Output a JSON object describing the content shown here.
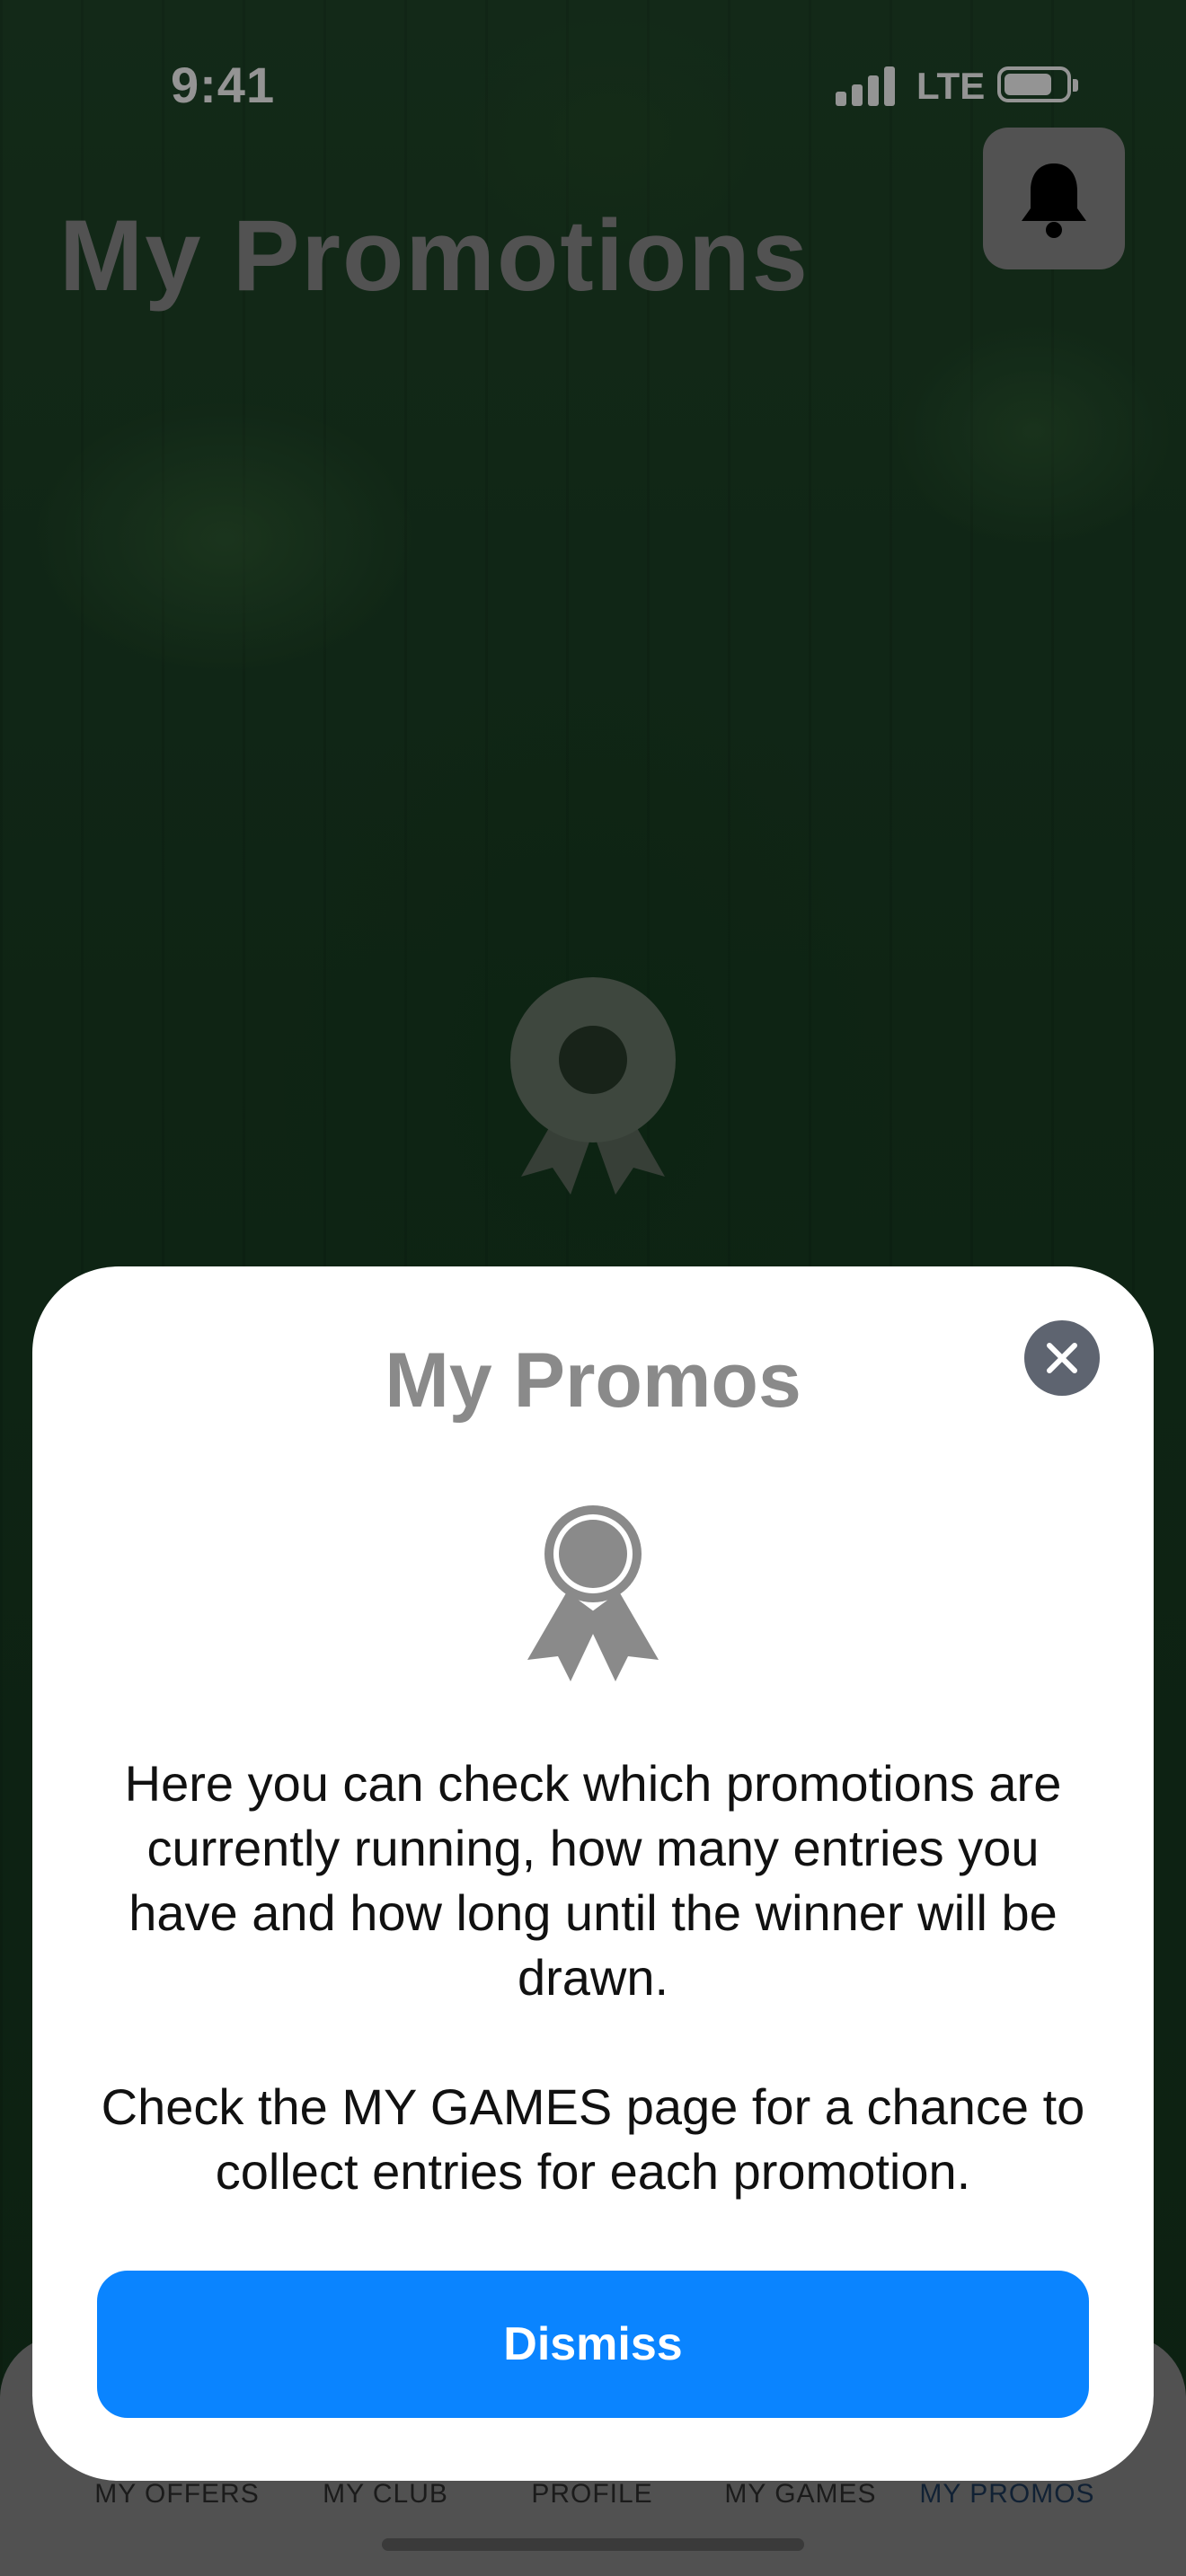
{
  "status_bar": {
    "time": "9:41",
    "network": "LTE"
  },
  "header": {
    "title": "My Promotions",
    "bell_icon": "bell-icon"
  },
  "tabs": [
    {
      "label": "MY OFFERS"
    },
    {
      "label": "MY CLUB"
    },
    {
      "label": "PROFILE"
    },
    {
      "label": "MY GAMES"
    },
    {
      "label": "MY PROMOS",
      "active": true
    }
  ],
  "modal": {
    "title": "My Promos",
    "body_1": "Here you can check which promotions are currently running, how many entries you have and how long until the winner will be drawn.",
    "body_2": "Check the MY GAMES page for a chance to collect entries for each promotion.",
    "dismiss_label": "Dismiss"
  },
  "colors": {
    "accent": "#0a84ff",
    "sheet_background": "#ffffff",
    "overlay": "rgba(0,0,0,0.42)"
  }
}
